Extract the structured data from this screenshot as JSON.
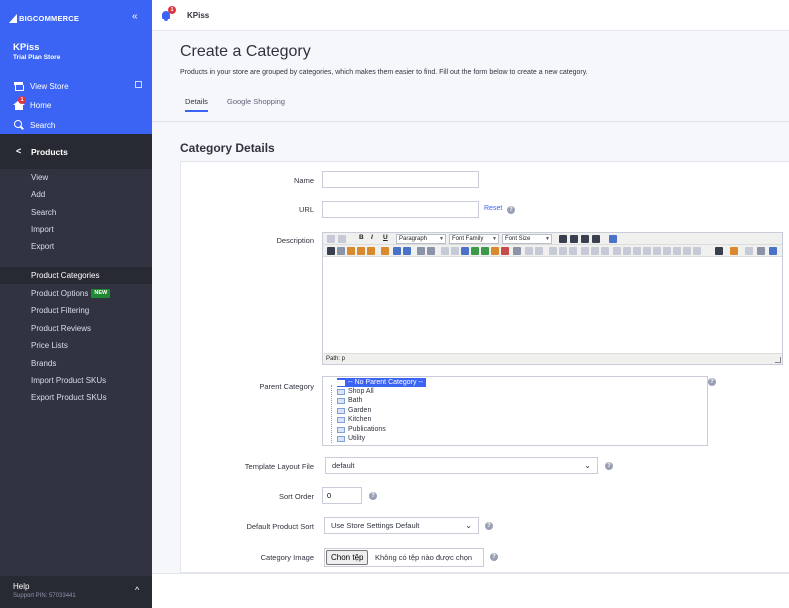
{
  "sidebar": {
    "logo_text": "BIGCOMMERCE",
    "collapse_icon": "double-chevron-left-icon",
    "store_name": "KPiss",
    "plan": "Trial Plan Store",
    "links": [
      {
        "label": "View Store",
        "icon": "store-icon"
      },
      {
        "label": "Home",
        "icon": "home-icon",
        "badge": "1"
      },
      {
        "label": "Search",
        "icon": "search-icon"
      }
    ],
    "section": {
      "label": "Products",
      "icon": "chevron-left-icon"
    },
    "items": [
      {
        "label": "View"
      },
      {
        "label": "Add"
      },
      {
        "label": "Search"
      },
      {
        "label": "Import"
      },
      {
        "label": "Export"
      },
      {
        "label": "Product Categories",
        "active": true
      },
      {
        "label": "Product Options",
        "badge": "NEW"
      },
      {
        "label": "Product Filtering"
      },
      {
        "label": "Product Reviews"
      },
      {
        "label": "Price Lists"
      },
      {
        "label": "Brands"
      },
      {
        "label": "Import Product SKUs"
      },
      {
        "label": "Export Product SKUs"
      }
    ],
    "help": "Help",
    "support_pin": "Support PIN: 57033441"
  },
  "topbar": {
    "notification_count": "1",
    "title": "KPiss"
  },
  "page": {
    "title": "Create a Category",
    "description": "Products in your store are grouped by categories, which makes them easier to find. Fill out the form below to create a new category.",
    "tabs": [
      {
        "label": "Details",
        "active": true
      },
      {
        "label": "Google Shopping"
      }
    ],
    "section_title": "Category Details"
  },
  "form": {
    "name_label": "Name",
    "name_value": "",
    "url_label": "URL",
    "url_value": "",
    "reset_label": "Reset",
    "description_label": "Description",
    "editor": {
      "paragraph": "Paragraph",
      "font_family": "Font Family",
      "font_size": "Font Size",
      "bold": "B",
      "italic": "I",
      "underline": "U",
      "path": "Path: p"
    },
    "parent_category_label": "Parent Category",
    "categories": [
      "-- No Parent Category --",
      "Shop All",
      "Bath",
      "Garden",
      "Kitchen",
      "Publications",
      "Utility"
    ],
    "template_label": "Template Layout File",
    "template_value": "default",
    "sort_order_label": "Sort Order",
    "sort_order_value": "0",
    "default_sort_label": "Default Product Sort",
    "default_sort_value": "Use Store Settings Default",
    "image_label": "Category Image",
    "file_button": "Chon tệp",
    "file_status": "Không có tệp nào được chọn"
  },
  "colors": {
    "brand_blue": "#3c64f4",
    "sidebar_dark": "#313440",
    "new_badge": "#208831",
    "alert_red": "#db3643"
  }
}
